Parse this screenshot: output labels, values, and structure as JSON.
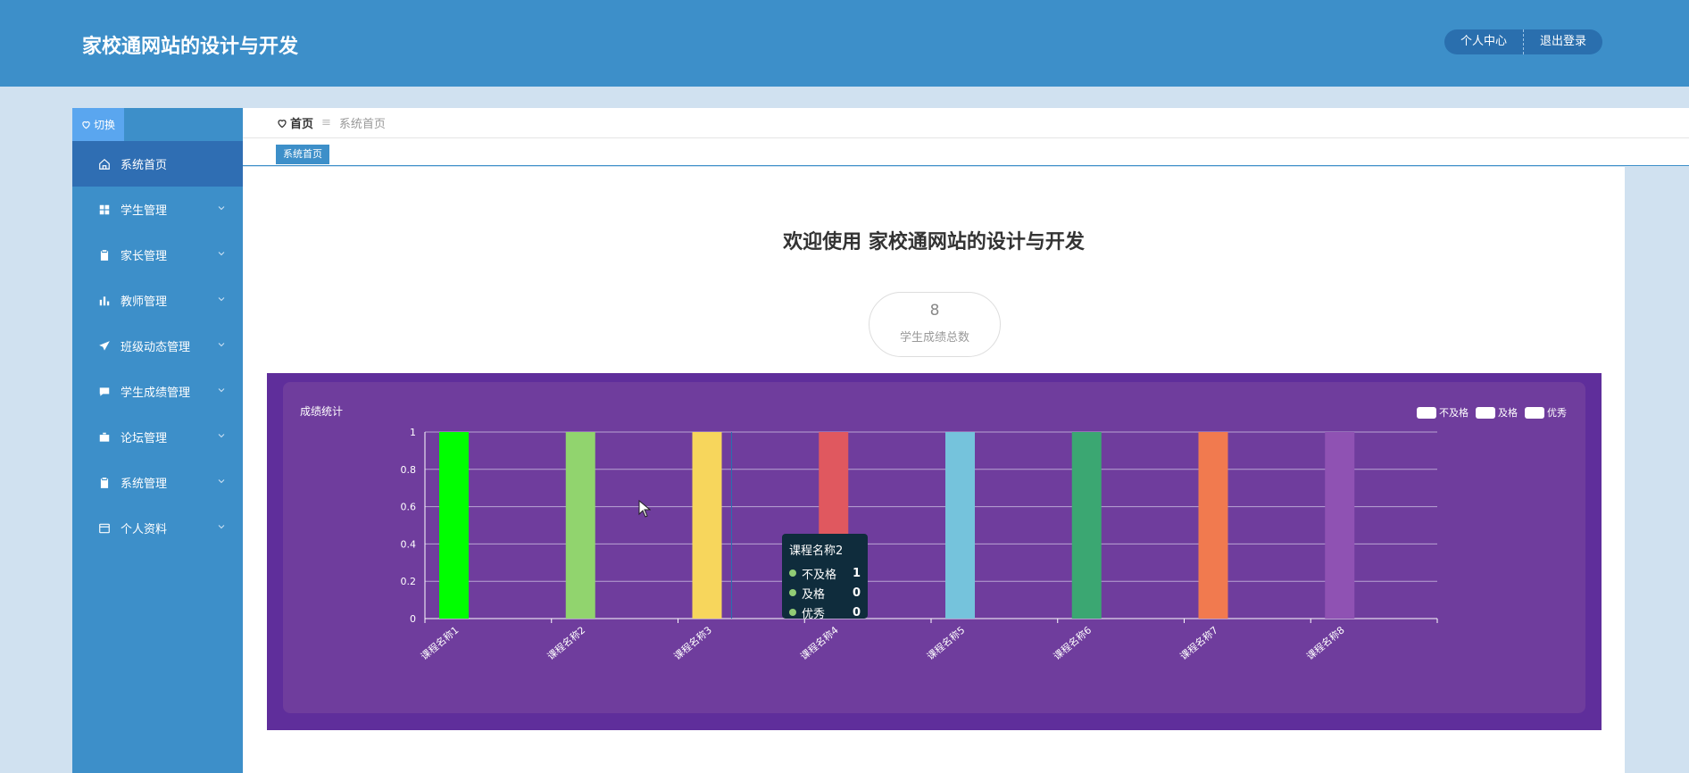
{
  "header": {
    "title": "家校通网站的设计与开发",
    "profile_label": "个人中心",
    "logout_label": "退出登录"
  },
  "sidebar": {
    "switch_label": "切换",
    "items": [
      {
        "label": "系统首页",
        "icon": "home-icon",
        "active": true
      },
      {
        "label": "学生管理",
        "icon": "grid-icon"
      },
      {
        "label": "家长管理",
        "icon": "clipboard-icon"
      },
      {
        "label": "教师管理",
        "icon": "bar-chart-icon"
      },
      {
        "label": "班级动态管理",
        "icon": "paper-plane-icon"
      },
      {
        "label": "学生成绩管理",
        "icon": "comment-icon"
      },
      {
        "label": "论坛管理",
        "icon": "briefcase-icon"
      },
      {
        "label": "系统管理",
        "icon": "clipboard-icon"
      },
      {
        "label": "个人资料",
        "icon": "card-icon"
      }
    ]
  },
  "breadcrumb": {
    "home": "首页",
    "separator": "≡",
    "current": "系统首页"
  },
  "tabs": [
    {
      "label": "系统首页"
    }
  ],
  "main": {
    "welcome": "欢迎使用 家校通网站的设计与开发",
    "stat_value": "8",
    "stat_label": "学生成绩总数"
  },
  "chart_data": {
    "type": "bar",
    "title": "成绩统计",
    "categories": [
      "课程名称1",
      "课程名称2",
      "课程名称3",
      "课程名称4",
      "课程名称5",
      "课程名称6",
      "课程名称7",
      "课程名称8"
    ],
    "values": [
      1,
      1,
      1,
      1,
      1,
      1,
      1,
      1
    ],
    "bar_colors": [
      "#00ff00",
      "#91d46e",
      "#f7d65c",
      "#e0585f",
      "#75c3dc",
      "#3ba772",
      "#f17a4f",
      "#8f52b3"
    ],
    "legend": [
      "不及格",
      "及格",
      "优秀"
    ],
    "legend_placement": "top-right",
    "ylim": [
      0,
      1
    ],
    "yticks": [
      "0",
      "0.2",
      "0.4",
      "0.6",
      "0.8",
      "1"
    ],
    "grid": true,
    "background": "#6f3d9d"
  },
  "tooltip": {
    "title": "课程名称2",
    "rows": [
      {
        "name": "不及格",
        "value": "1"
      },
      {
        "name": "及格",
        "value": "0"
      },
      {
        "name": "优秀",
        "value": "0"
      }
    ]
  }
}
